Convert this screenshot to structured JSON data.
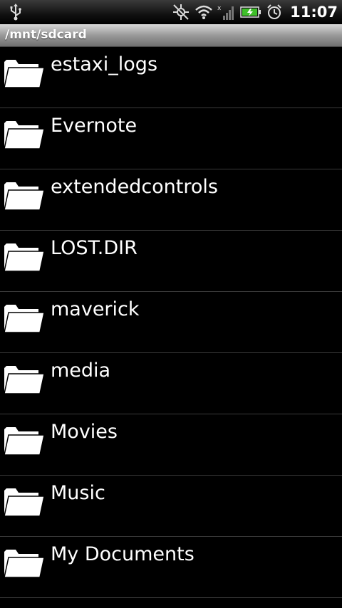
{
  "status_bar": {
    "time": "11:07",
    "icons": [
      "usb-icon",
      "gps-icon",
      "wifi-icon",
      "signal-icon",
      "battery-charging-icon",
      "alarm-icon"
    ]
  },
  "path": "/mnt/sdcard",
  "folders": [
    {
      "label": "estaxi_logs"
    },
    {
      "label": "Evernote"
    },
    {
      "label": "extendedcontrols"
    },
    {
      "label": "LOST.DIR"
    },
    {
      "label": "maverick"
    },
    {
      "label": "media"
    },
    {
      "label": "Movies"
    },
    {
      "label": "Music"
    },
    {
      "label": "My Documents"
    }
  ],
  "colors": {
    "background": "#000000",
    "text": "#ffffff",
    "battery": "#3fbf2a"
  }
}
